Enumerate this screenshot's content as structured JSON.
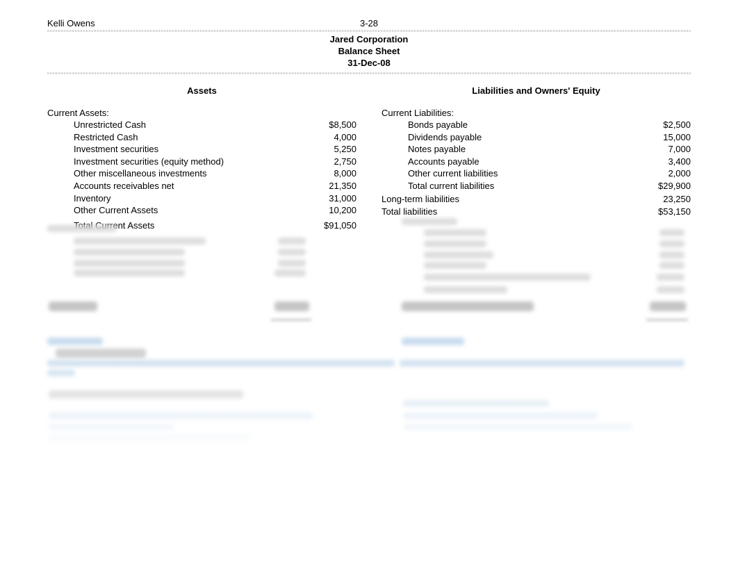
{
  "header": {
    "name": "Kelli Owens",
    "page_ref": "3-28",
    "company": "Jared Corporation",
    "title": "Balance Sheet",
    "date": "31-Dec-08"
  },
  "left": {
    "heading": "Assets",
    "section_label": "Current Assets:",
    "items": [
      {
        "label": "Unrestricted Cash",
        "value": "$8,500"
      },
      {
        "label": "Restricted Cash",
        "value": "4,000"
      },
      {
        "label": "Investment securities",
        "value": "5,250"
      },
      {
        "label": "Investment securities (equity method)",
        "value": "2,750"
      },
      {
        "label": "Other miscellaneous investments",
        "value": "8,000"
      },
      {
        "label": "Accounts receivables net",
        "value": "21,350"
      },
      {
        "label": "Inventory",
        "value": "31,000"
      },
      {
        "label": "Other Current Assets",
        "value": "10,200"
      }
    ],
    "total_label": "Total Current Assets",
    "total_value": "$91,050"
  },
  "right": {
    "heading": "Liabilities and Owners' Equity",
    "section_label": "Current Liabilities:",
    "items": [
      {
        "label": "Bonds payable",
        "value": "$2,500"
      },
      {
        "label": "Dividends payable",
        "value": "15,000"
      },
      {
        "label": "Notes payable",
        "value": "7,000"
      },
      {
        "label": "Accounts payable",
        "value": "3,400"
      },
      {
        "label": "Other current liabilities",
        "value": "2,000"
      },
      {
        "label": "Total current liabilities",
        "value": "$29,900"
      }
    ],
    "long_term_label": "Long-term liabilities",
    "long_term_value": "23,250",
    "total_liab_label": "Total liabilities",
    "total_liab_value": "$53,150"
  }
}
